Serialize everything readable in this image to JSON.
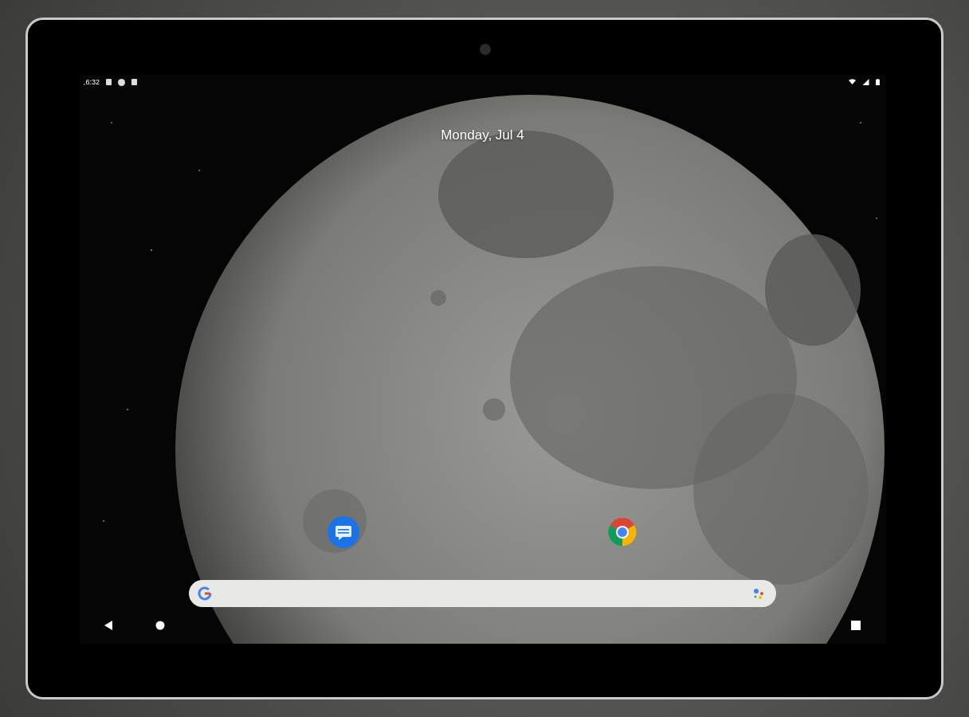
{
  "status_bar": {
    "time": "6:32"
  },
  "date": "Monday, Jul 4",
  "home_apps": [
    {
      "kind": "messages"
    },
    {
      "kind": "browser"
    }
  ]
}
